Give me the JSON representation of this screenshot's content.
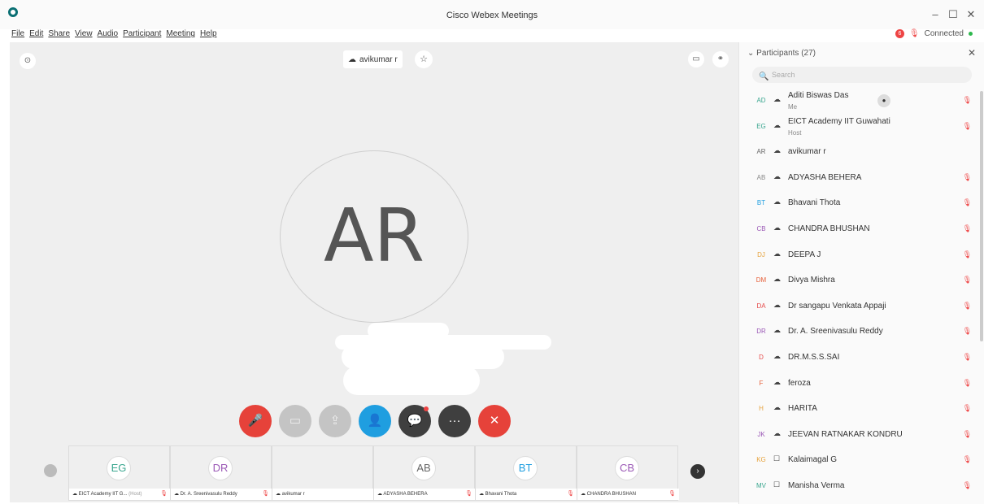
{
  "window": {
    "title": "Cisco Webex Meetings",
    "min": "–",
    "max": "☐",
    "close": "✕"
  },
  "menu": [
    "File",
    "Edit",
    "Share",
    "View",
    "Audio",
    "Participant",
    "Meeting",
    "Help"
  ],
  "status": {
    "rec_count": "6",
    "label": "Connected"
  },
  "stage": {
    "speaker_name": "avikumar r",
    "active_initials": "AR"
  },
  "controls": [
    "mute",
    "video",
    "share",
    "participants",
    "chat",
    "more",
    "leave"
  ],
  "thumbnails": [
    {
      "initials": "EG",
      "color": "#3aa68f",
      "label": "EICT Academy IIT G...",
      "suffix": "(Host)",
      "muted": true
    },
    {
      "initials": "DR",
      "color": "#9b59b6",
      "label": "Dr. A. Sreenivasulu Reddy",
      "suffix": "",
      "muted": true
    },
    {
      "initials": "",
      "color": "#333",
      "label": "avikumar r",
      "suffix": "",
      "muted": false
    },
    {
      "initials": "AB",
      "color": "#666",
      "label": "ADYASHA BEHERA",
      "suffix": "",
      "muted": true
    },
    {
      "initials": "BT",
      "color": "#1f9ee0",
      "label": "Bhavani Thota",
      "suffix": "",
      "muted": true
    },
    {
      "initials": "CB",
      "color": "#9b59b6",
      "label": "CHANDRA BHUSHAN",
      "suffix": "",
      "muted": true
    }
  ],
  "panel": {
    "title": "Participants (27)",
    "search_placeholder": "Search",
    "participants": [
      {
        "initials": "AD",
        "color": "#3aa68f",
        "name": "Aditi Biswas Das",
        "sub": "Me",
        "icon": "audio",
        "muted": true
      },
      {
        "initials": "EG",
        "color": "#3aa68f",
        "name": "EICT Academy IIT Guwahati",
        "sub": "Host",
        "icon": "audio",
        "muted": true
      },
      {
        "initials": "AR",
        "color": "#666",
        "name": "avikumar r",
        "sub": "",
        "icon": "audio",
        "muted": false
      },
      {
        "initials": "AB",
        "color": "#888",
        "name": "ADYASHA BEHERA",
        "sub": "",
        "icon": "audio",
        "muted": true
      },
      {
        "initials": "BT",
        "color": "#1f9ee0",
        "name": "Bhavani Thota",
        "sub": "",
        "icon": "audio",
        "muted": true
      },
      {
        "initials": "CB",
        "color": "#9b59b6",
        "name": "CHANDRA BHUSHAN",
        "sub": "",
        "icon": "audio",
        "muted": true
      },
      {
        "initials": "DJ",
        "color": "#e6a23c",
        "name": "DEEPA J",
        "sub": "",
        "icon": "audio",
        "muted": true
      },
      {
        "initials": "DM",
        "color": "#e6603a",
        "name": "Divya Mishra",
        "sub": "",
        "icon": "audio",
        "muted": true
      },
      {
        "initials": "DA",
        "color": "#e64a4a",
        "name": "Dr sangapu Venkata Appaji",
        "sub": "",
        "icon": "audio",
        "muted": true
      },
      {
        "initials": "DR",
        "color": "#9b59b6",
        "name": "Dr. A. Sreenivasulu Reddy",
        "sub": "",
        "icon": "audio",
        "muted": true
      },
      {
        "initials": "D",
        "color": "#e64a4a",
        "name": "DR.M.S.S.SAI",
        "sub": "",
        "icon": "audio",
        "muted": true
      },
      {
        "initials": "F",
        "color": "#e6603a",
        "name": "feroza",
        "sub": "",
        "icon": "audio",
        "muted": true
      },
      {
        "initials": "H",
        "color": "#e6a23c",
        "name": "HARITA",
        "sub": "",
        "icon": "audio",
        "muted": true
      },
      {
        "initials": "JK",
        "color": "#9b59b6",
        "name": "JEEVAN RATNAKAR KONDRU",
        "sub": "",
        "icon": "audio",
        "muted": true
      },
      {
        "initials": "KG",
        "color": "#e6a23c",
        "name": "Kalaimagal G",
        "sub": "",
        "icon": "phone",
        "muted": true
      },
      {
        "initials": "MV",
        "color": "#3aa68f",
        "name": "Manisha Verma",
        "sub": "",
        "icon": "phone",
        "muted": true
      }
    ]
  }
}
